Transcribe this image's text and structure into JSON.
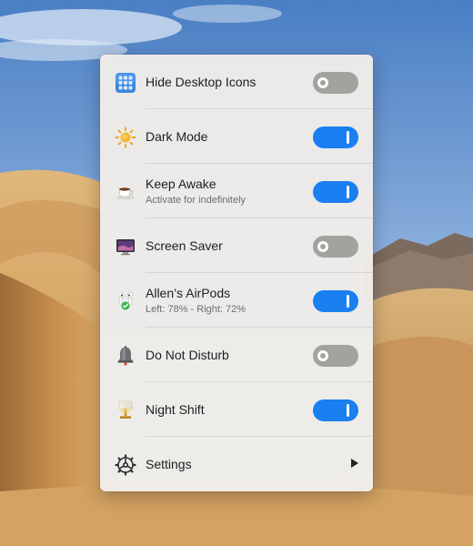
{
  "menu": {
    "items": [
      {
        "icon": "grid-apps-icon",
        "title": "Hide Desktop Icons",
        "subtitle": "",
        "control": "toggle",
        "enabled": false
      },
      {
        "icon": "sun-icon",
        "title": "Dark Mode",
        "subtitle": "",
        "control": "toggle",
        "enabled": true
      },
      {
        "icon": "coffee-cup-icon",
        "title": "Keep Awake",
        "subtitle": "Activate for indefinitely",
        "control": "toggle",
        "enabled": true
      },
      {
        "icon": "monitor-icon",
        "title": "Screen Saver",
        "subtitle": "",
        "control": "toggle",
        "enabled": false
      },
      {
        "icon": "airpods-icon",
        "title": "Allen’s AirPods",
        "subtitle": "Left: 78% - Right: 72%",
        "control": "toggle",
        "enabled": true
      },
      {
        "icon": "bell-icon",
        "title": "Do Not Disturb",
        "subtitle": "",
        "control": "toggle",
        "enabled": false
      },
      {
        "icon": "lamp-icon",
        "title": "Night Shift",
        "subtitle": "",
        "control": "toggle",
        "enabled": true
      },
      {
        "icon": "gear-icon",
        "title": "Settings",
        "subtitle": "",
        "control": "submenu-arrow",
        "enabled": null
      }
    ]
  },
  "colors": {
    "toggle_on": "#1a7ff0",
    "toggle_off": "#a3a29f",
    "panel_bg": "#f0ede9"
  }
}
